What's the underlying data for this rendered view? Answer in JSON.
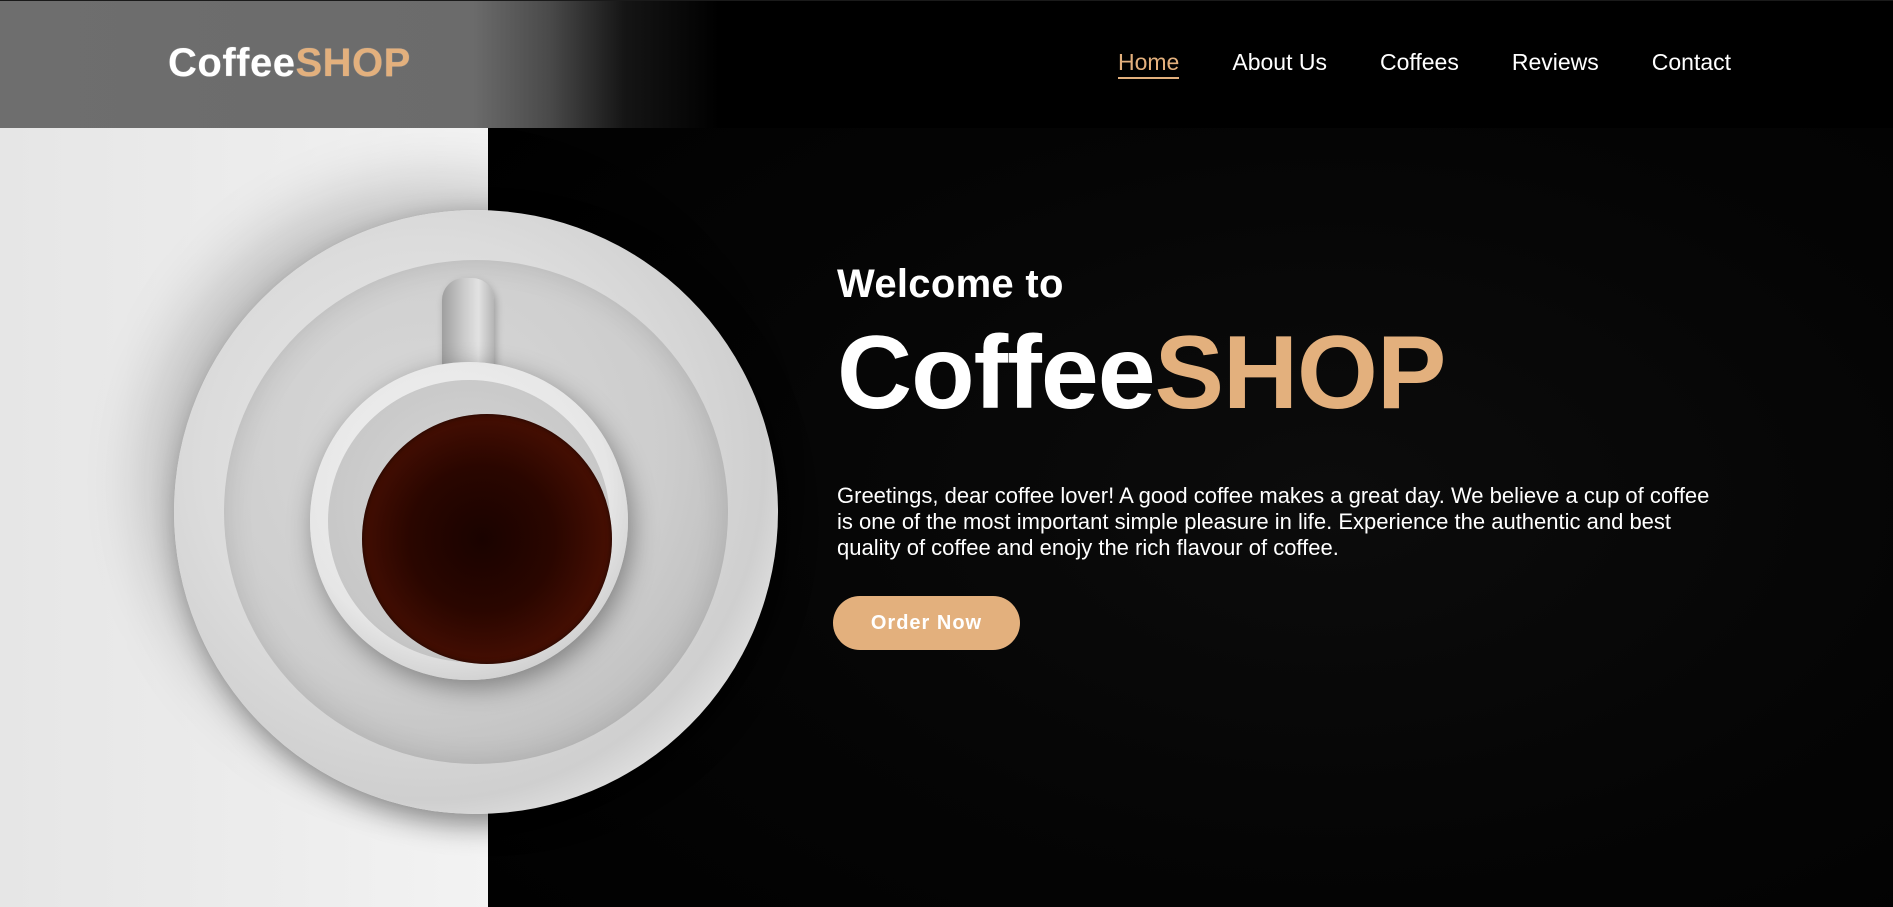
{
  "header": {
    "logo": {
      "part1": "Coffee",
      "part2": "SHOP"
    },
    "nav": [
      {
        "label": "Home",
        "active": true
      },
      {
        "label": "About Us",
        "active": false
      },
      {
        "label": "Coffees",
        "active": false
      },
      {
        "label": "Reviews",
        "active": false
      },
      {
        "label": "Contact",
        "active": false
      }
    ]
  },
  "hero": {
    "kicker": "Welcome to",
    "title_part1": "Coffee",
    "title_part2": "SHOP",
    "text": "Greetings, dear coffee lover! A good coffee makes a great day. We believe a cup of coffee is one of the most important simple pleasure in life. Experience the authentic and best quality of coffee and enojy the rich flavour of coffee.",
    "button_label": "Order Now"
  },
  "colors": {
    "accent": "#e3b07d",
    "background": "#000000",
    "text": "#ffffff"
  }
}
